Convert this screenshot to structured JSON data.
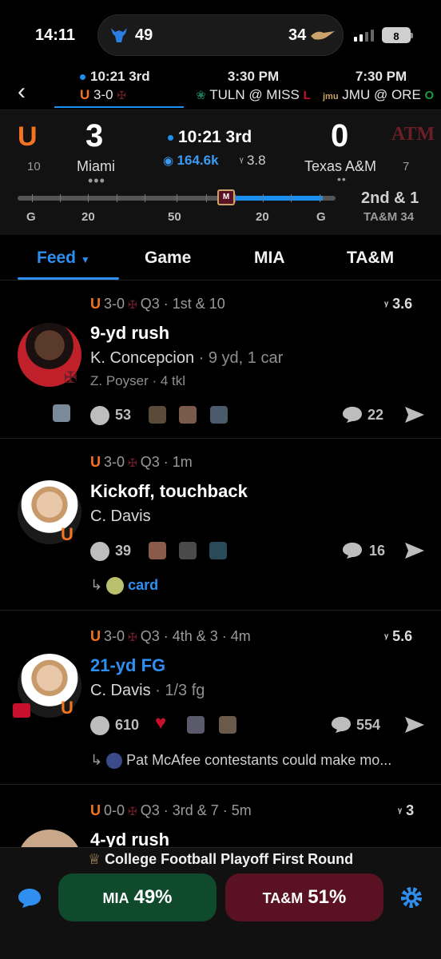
{
  "status_bar": {
    "time": "14:11",
    "live_left_score": "49",
    "live_right_score": "34",
    "battery": "8"
  },
  "strip": {
    "games": [
      {
        "time": "10:21 3rd",
        "matchup_prefix": "",
        "matchup": "3-0"
      },
      {
        "time": "3:30 PM",
        "matchup": "TULN @ MISS"
      },
      {
        "time": "7:30 PM",
        "matchup": "JMU @ ORE"
      }
    ]
  },
  "game": {
    "home": {
      "name": "Miami",
      "rank": "10",
      "score": "3",
      "logo": "U"
    },
    "away": {
      "name": "Texas A&M",
      "rank": "7",
      "score": "0",
      "logo": "ATM"
    },
    "clock": "10:21 3rd",
    "viewers": "164.6k",
    "vote_score": "3.8",
    "yard_labels": [
      "G",
      "20",
      "50",
      "20",
      "G"
    ],
    "down_distance": "2nd & 1",
    "ball_on": "TA&M 34"
  },
  "tabs": [
    "Feed",
    "Game",
    "MIA",
    "TA&M"
  ],
  "feed": [
    {
      "score": "3-0",
      "meta": "Q3 · 1st & 10",
      "vote": "3.6",
      "title": "9-yd rush",
      "title_style": "white",
      "player": "K. Concepcion",
      "player_stat": " · 9 yd, 1 car",
      "player2": "Z. Poyser · 4 tkl",
      "smiley_count": "53",
      "comments": "22",
      "reply": ""
    },
    {
      "score": "3-0",
      "meta": "Q3 · 1m",
      "vote": "",
      "title": "Kickoff, touchback",
      "title_style": "white",
      "player": "C. Davis",
      "player_stat": "",
      "player2": "",
      "smiley_count": "39",
      "comments": "16",
      "reply": "card"
    },
    {
      "score": "3-0",
      "meta": "Q3 · 4th & 3 · 4m",
      "vote": "5.6",
      "title": "21-yd FG",
      "title_style": "blue",
      "player": "C. Davis",
      "player_stat": " · 1/3 fg",
      "player2": "",
      "smiley_count": "610",
      "comments": "554",
      "reply": "Pat McAfee contestants could make mo..."
    },
    {
      "score": "0-0",
      "meta": "Q3 · 3rd & 7 · 5m",
      "vote": "3",
      "title": "4-yd rush",
      "title_style": "white"
    }
  ],
  "bottom": {
    "banner": "College Football Playoff First Round",
    "left_pill": {
      "abbr": "MIA",
      "pct": "49%",
      "color": "#0f4a2d"
    },
    "right_pill": {
      "abbr": "TA&M",
      "pct": "51%",
      "color": "#5a1222"
    }
  },
  "colors": {
    "accent": "#2f8ff0",
    "miami_orange": "#f47321",
    "tam_maroon": "#6b1e28"
  }
}
